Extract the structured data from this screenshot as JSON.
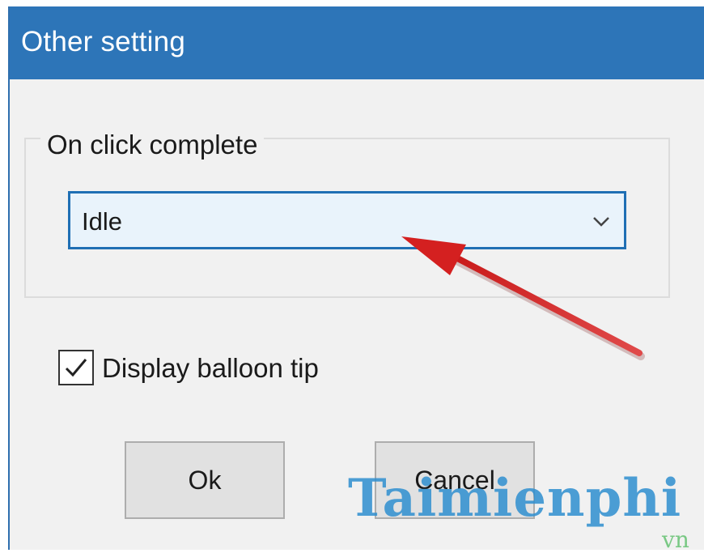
{
  "window": {
    "title": "Other setting"
  },
  "group": {
    "label": "On click complete"
  },
  "dropdown": {
    "selected": "Idle",
    "icon": "chevron-down-icon"
  },
  "checkbox": {
    "label": "Display balloon tip",
    "checked": true
  },
  "buttons": {
    "ok_label": "Ok",
    "cancel_label": "Cancel"
  },
  "watermark": {
    "text": "Taimienphi",
    "sub": "vn"
  },
  "colors": {
    "titlebar": "#2d75b8",
    "combo_border": "#1f6fb4",
    "arrow": "#d42020",
    "watermark": "#2f8fd0"
  }
}
